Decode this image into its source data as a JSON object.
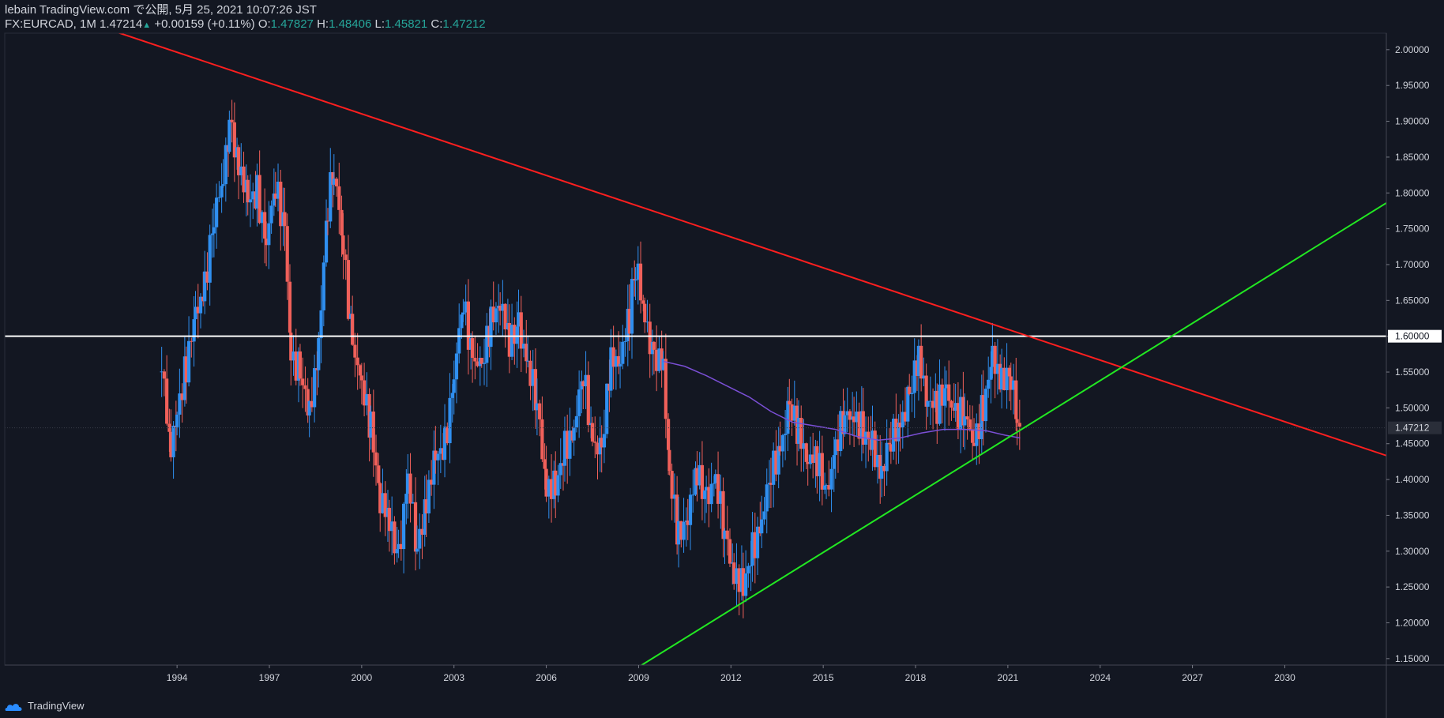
{
  "header": {
    "published_line": "lebain TradingView.com で公開, 5月 25, 2021 10:07:26 JST",
    "symbol": "FX:EURCAD, 1M",
    "last": "1.47214",
    "change": "+0.00159 (+0.11%)",
    "open_label": "O:",
    "open": "1.47827",
    "high_label": "H:",
    "high": "1.48406",
    "low_label": "L:",
    "low": "1.45821",
    "close_label": "C:",
    "close": "1.47212"
  },
  "brand": {
    "name": "TradingView",
    "icon": "tradingview-cloud-icon"
  },
  "colors": {
    "background": "#131722",
    "up": "#2f8ff0",
    "down": "#f0605a",
    "resistance": "#ff1f1f",
    "support": "#22e822",
    "horizontal": "#ffffff",
    "ma": "#7b4fd6",
    "price_badge": "#2a2e39"
  },
  "chart_data": {
    "type": "candlestick",
    "x_axis": {
      "ticks": [
        "1994",
        "1997",
        "2000",
        "2003",
        "2006",
        "2009",
        "2012",
        "2015",
        "2018",
        "2021",
        "2024",
        "2027",
        "2030"
      ],
      "range": [
        1988.4,
        2033.3
      ]
    },
    "y_axis": {
      "ticks": [
        "2.00000",
        "1.95000",
        "1.90000",
        "1.85000",
        "1.80000",
        "1.75000",
        "1.70000",
        "1.65000",
        "1.60000",
        "1.55000",
        "1.50000",
        "1.45000",
        "1.40000",
        "1.35000",
        "1.30000",
        "1.25000",
        "1.20000",
        "1.15000"
      ],
      "range": [
        1.141,
        2.023
      ]
    },
    "current_price": "1.47212",
    "horizontal_level": {
      "value": 1.6,
      "label": "1.60000"
    },
    "trendlines": [
      {
        "name": "resistance",
        "points": [
          [
            1992.0,
            2.025
          ],
          [
            2033.4,
            1.432
          ]
        ]
      },
      {
        "name": "support",
        "points": [
          [
            2009.1,
            1.141
          ],
          [
            2033.3,
            1.786
          ]
        ]
      }
    ],
    "closes_monthly_approx": [
      [
        1993.5,
        1.55
      ],
      [
        1993.8,
        1.45
      ],
      [
        1994.0,
        1.5
      ],
      [
        1994.3,
        1.56
      ],
      [
        1994.6,
        1.62
      ],
      [
        1994.9,
        1.68
      ],
      [
        1995.2,
        1.76
      ],
      [
        1995.5,
        1.82
      ],
      [
        1995.7,
        1.9
      ],
      [
        1996.0,
        1.85
      ],
      [
        1996.3,
        1.78
      ],
      [
        1996.6,
        1.8
      ],
      [
        1996.9,
        1.74
      ],
      [
        1997.2,
        1.8
      ],
      [
        1997.5,
        1.76
      ],
      [
        1997.7,
        1.58
      ],
      [
        1998.0,
        1.55
      ],
      [
        1998.3,
        1.48
      ],
      [
        1998.6,
        1.6
      ],
      [
        1998.9,
        1.78
      ],
      [
        1999.1,
        1.83
      ],
      [
        1999.4,
        1.72
      ],
      [
        1999.7,
        1.6
      ],
      [
        2000.0,
        1.52
      ],
      [
        2000.3,
        1.48
      ],
      [
        2000.6,
        1.38
      ],
      [
        2000.9,
        1.33
      ],
      [
        2001.2,
        1.3
      ],
      [
        2001.5,
        1.4
      ],
      [
        2001.8,
        1.3
      ],
      [
        2002.1,
        1.38
      ],
      [
        2002.4,
        1.42
      ],
      [
        2002.7,
        1.45
      ],
      [
        2003.0,
        1.55
      ],
      [
        2003.3,
        1.64
      ],
      [
        2003.6,
        1.58
      ],
      [
        2003.9,
        1.55
      ],
      [
        2004.2,
        1.62
      ],
      [
        2004.5,
        1.66
      ],
      [
        2004.8,
        1.58
      ],
      [
        2005.1,
        1.62
      ],
      [
        2005.4,
        1.56
      ],
      [
        2005.7,
        1.5
      ],
      [
        2006.0,
        1.4
      ],
      [
        2006.3,
        1.38
      ],
      [
        2006.6,
        1.44
      ],
      [
        2006.9,
        1.48
      ],
      [
        2007.2,
        1.54
      ],
      [
        2007.5,
        1.46
      ],
      [
        2007.8,
        1.44
      ],
      [
        2008.1,
        1.56
      ],
      [
        2008.4,
        1.58
      ],
      [
        2008.7,
        1.62
      ],
      [
        2008.9,
        1.7
      ],
      [
        2009.2,
        1.62
      ],
      [
        2009.5,
        1.58
      ],
      [
        2009.8,
        1.55
      ],
      [
        2010.0,
        1.4
      ],
      [
        2010.3,
        1.32
      ],
      [
        2010.6,
        1.36
      ],
      [
        2010.9,
        1.4
      ],
      [
        2011.2,
        1.38
      ],
      [
        2011.5,
        1.4
      ],
      [
        2011.8,
        1.32
      ],
      [
        2012.1,
        1.28
      ],
      [
        2012.4,
        1.24
      ],
      [
        2012.7,
        1.3
      ],
      [
        2013.0,
        1.35
      ],
      [
        2013.3,
        1.4
      ],
      [
        2013.6,
        1.45
      ],
      [
        2013.9,
        1.5
      ],
      [
        2014.2,
        1.46
      ],
      [
        2014.5,
        1.44
      ],
      [
        2014.8,
        1.42
      ],
      [
        2015.1,
        1.38
      ],
      [
        2015.4,
        1.45
      ],
      [
        2015.7,
        1.48
      ],
      [
        2016.0,
        1.5
      ],
      [
        2016.3,
        1.46
      ],
      [
        2016.6,
        1.44
      ],
      [
        2016.9,
        1.42
      ],
      [
        2017.2,
        1.45
      ],
      [
        2017.5,
        1.48
      ],
      [
        2017.8,
        1.52
      ],
      [
        2018.1,
        1.56
      ],
      [
        2018.4,
        1.52
      ],
      [
        2018.7,
        1.5
      ],
      [
        2019.0,
        1.52
      ],
      [
        2019.3,
        1.5
      ],
      [
        2019.6,
        1.48
      ],
      [
        2019.9,
        1.46
      ],
      [
        2020.2,
        1.5
      ],
      [
        2020.5,
        1.56
      ],
      [
        2020.8,
        1.55
      ],
      [
        2021.1,
        1.54
      ],
      [
        2021.3,
        1.48
      ],
      [
        2021.4,
        1.47212
      ]
    ],
    "ma_line_approx": [
      [
        2009.8,
        1.565
      ],
      [
        2010.5,
        1.558
      ],
      [
        2011.2,
        1.545
      ],
      [
        2011.9,
        1.53
      ],
      [
        2012.6,
        1.515
      ],
      [
        2013.3,
        1.495
      ],
      [
        2014.0,
        1.48
      ],
      [
        2014.7,
        1.475
      ],
      [
        2015.4,
        1.47
      ],
      [
        2016.1,
        1.46
      ],
      [
        2016.8,
        1.455
      ],
      [
        2017.5,
        1.458
      ],
      [
        2018.2,
        1.465
      ],
      [
        2018.9,
        1.47
      ],
      [
        2019.6,
        1.47
      ],
      [
        2020.3,
        1.468
      ],
      [
        2020.9,
        1.462
      ],
      [
        2021.4,
        1.458
      ]
    ]
  }
}
